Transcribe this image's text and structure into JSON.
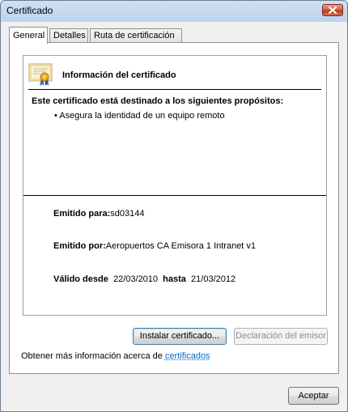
{
  "window": {
    "title": "Certificado"
  },
  "tabs": [
    {
      "label": "General",
      "active": true
    },
    {
      "label": "Detalles",
      "active": false
    },
    {
      "label": "Ruta de certificación",
      "active": false
    }
  ],
  "info": {
    "title": "Información del certificado",
    "purposes_heading": "Este certificado está destinado a los siguientes propósitos:",
    "purposes": [
      "• Asegura la identidad de un equipo remoto"
    ]
  },
  "fields": {
    "issued_to_label": "Emitido para:",
    "issued_to_value": "sd03144",
    "issued_by_label": "Emitido por:",
    "issued_by_value": "Aeropuertos CA Emisora 1 Intranet v1",
    "valid_from_label": "Válido desde",
    "valid_from_value": "22/03/2010",
    "valid_to_label": "hasta",
    "valid_to_value": "21/03/2012"
  },
  "buttons": {
    "install": "Instalar certificado...",
    "issuer_statement": "Declaración del emisor",
    "accept": "Aceptar"
  },
  "more_info": {
    "text": "Obtener más información acerca de ",
    "link": "certificados"
  },
  "icons": {
    "close": "close-icon",
    "certificate": "certificate-icon"
  },
  "colors": {
    "link": "#0066cc",
    "close_button": "#c9462c",
    "default_button_border": "#3c7fb1"
  }
}
